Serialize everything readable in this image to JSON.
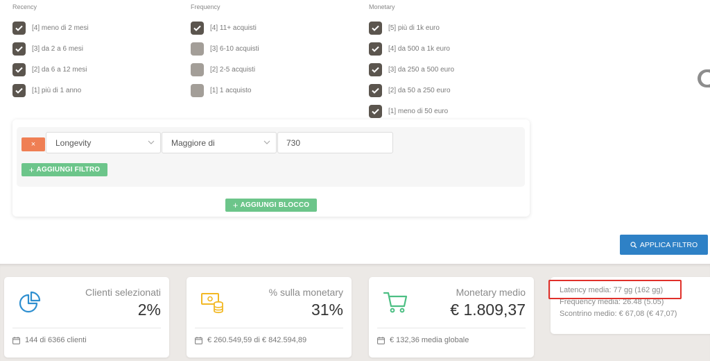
{
  "recency": {
    "title": "Recency",
    "items": [
      {
        "label": "[4] meno di 2 mesi",
        "checked": true
      },
      {
        "label": "[3] da 2 a 6 mesi",
        "checked": true
      },
      {
        "label": "[2] da 6 a 12 mesi",
        "checked": true
      },
      {
        "label": "[1] più di 1 anno",
        "checked": true
      }
    ]
  },
  "frequency": {
    "title": "Frequency",
    "items": [
      {
        "label": "[4] 11+ acquisti",
        "checked": true
      },
      {
        "label": "[3] 6-10 acquisti",
        "checked": false
      },
      {
        "label": "[2] 2-5 acquisti",
        "checked": false
      },
      {
        "label": "[1] 1 acquisto",
        "checked": false
      }
    ]
  },
  "monetary": {
    "title": "Monetary",
    "items": [
      {
        "label": "[5] più di 1k euro",
        "checked": true
      },
      {
        "label": "[4] da 500 a 1k euro",
        "checked": true
      },
      {
        "label": "[3] da 250 a 500 euro",
        "checked": true
      },
      {
        "label": "[2] da 50 a 250 euro",
        "checked": true
      },
      {
        "label": "[1] meno di 50 euro",
        "checked": true
      }
    ]
  },
  "filter": {
    "remove_label": "×",
    "field": "Longevity",
    "operator": "Maggiore di",
    "value": "730",
    "add_filter": "AGGIUNGI FILTRO",
    "add_block": "AGGIUNGI BLOCCO",
    "apply": "APPLICA FILTRO"
  },
  "stats": {
    "clients": {
      "title": "Clienti selezionati",
      "value": "2%",
      "footer": "144 di 6366 clienti"
    },
    "monetary_share": {
      "title": "% sulla monetary",
      "value": "31%",
      "footer": "€ 260.549,59 di € 842.594,89"
    },
    "monetary_avg": {
      "title": "Monetary medio",
      "value": "€ 1.809,37",
      "footer": "€ 132,36 media globale"
    }
  },
  "averages": {
    "latency": "Latency media: 77 gg (162 gg)",
    "frequency": "Frequency media: 26.48 (5.05)",
    "receipt": "Scontrino medio: € 67,08 (€ 47,07)"
  },
  "colors": {
    "checked": "#5b554e",
    "unchecked": "#a39e98",
    "remove": "#ef7f54",
    "green": "#6cc58a",
    "blue": "#2e81c6",
    "highlight": "#e0302a",
    "icon_blue": "#2e8fd0",
    "icon_yellow": "#f2b824",
    "icon_green": "#4cbf83"
  }
}
